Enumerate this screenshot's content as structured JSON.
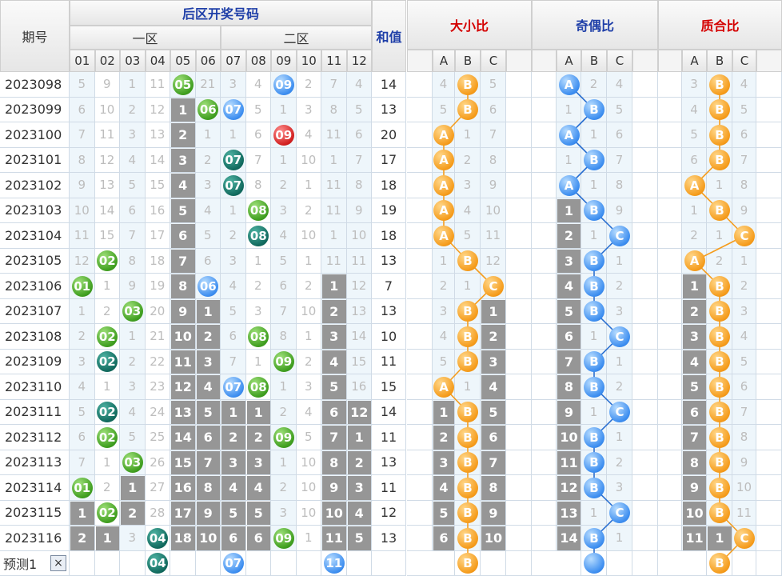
{
  "header": {
    "issue_label": "期号",
    "back_zone_title": "后区开奖号码",
    "zone1_label": "一区",
    "zone2_label": "二区",
    "sum_label": "和值",
    "size_ratio_label": "大小比",
    "parity_ratio_label": "奇偶比",
    "prime_ratio_label": "质合比",
    "numbers": [
      "01",
      "02",
      "03",
      "04",
      "05",
      "06",
      "07",
      "08",
      "09",
      "10",
      "11",
      "12"
    ],
    "abc": [
      "A",
      "B",
      "C"
    ]
  },
  "colors": {
    "size_title": "#d40000",
    "parity_title": "#1f3fa8",
    "prime_title": "#d40000",
    "back_title": "#1f3fa8",
    "sum_title": "#1f3fa8"
  },
  "rows": [
    {
      "issue": "2023098",
      "cells": [
        "5",
        "9",
        "1",
        "11",
        "05",
        "21",
        "3",
        "4",
        "09",
        "2",
        "7",
        "4"
      ],
      "sum": "14",
      "size": [
        "4",
        "B",
        "5"
      ],
      "parity": [
        "A",
        "2",
        "4"
      ],
      "prime": [
        "3",
        "B",
        "4"
      ]
    },
    {
      "issue": "2023099",
      "cells": [
        "6",
        "10",
        "2",
        "12",
        "1",
        "06",
        "07",
        "5",
        "1",
        "3",
        "8",
        "5"
      ],
      "sum": "13",
      "size": [
        "5",
        "B",
        "6"
      ],
      "parity": [
        "1",
        "B",
        "5"
      ],
      "prime": [
        "4",
        "B",
        "5"
      ]
    },
    {
      "issue": "2023100",
      "cells": [
        "7",
        "11",
        "3",
        "13",
        "2",
        "1",
        "1",
        "6",
        "09",
        "4",
        "11",
        "6"
      ],
      "sum": "20",
      "size": [
        "A",
        "1",
        "7"
      ],
      "parity": [
        "A",
        "1",
        "6"
      ],
      "prime": [
        "5",
        "B",
        "6"
      ]
    },
    {
      "issue": "2023101",
      "cells": [
        "8",
        "12",
        "4",
        "14",
        "3",
        "2",
        "07",
        "7",
        "1",
        "10",
        "1",
        "7"
      ],
      "sum": "17",
      "size": [
        "A",
        "2",
        "8"
      ],
      "parity": [
        "1",
        "B",
        "7"
      ],
      "prime": [
        "6",
        "B",
        "7"
      ]
    },
    {
      "issue": "2023102",
      "cells": [
        "9",
        "13",
        "5",
        "15",
        "4",
        "3",
        "07",
        "8",
        "2",
        "1",
        "11",
        "8"
      ],
      "sum": "18",
      "size": [
        "A",
        "3",
        "9"
      ],
      "parity": [
        "A",
        "1",
        "8"
      ],
      "prime": [
        "A",
        "1",
        "8"
      ]
    },
    {
      "issue": "2023103",
      "cells": [
        "10",
        "14",
        "6",
        "16",
        "5",
        "4",
        "1",
        "08",
        "3",
        "2",
        "11",
        "9"
      ],
      "sum": "19",
      "size": [
        "A",
        "4",
        "10"
      ],
      "parity": [
        "1",
        "B",
        "9"
      ],
      "prime": [
        "1",
        "B",
        "9"
      ]
    },
    {
      "issue": "2023104",
      "cells": [
        "11",
        "15",
        "7",
        "17",
        "6",
        "5",
        "2",
        "08",
        "4",
        "10",
        "1",
        "10"
      ],
      "sum": "18",
      "size": [
        "A",
        "5",
        "11"
      ],
      "parity": [
        "2",
        "1",
        "C"
      ],
      "prime": [
        "2",
        "1",
        "C"
      ]
    },
    {
      "issue": "2023105",
      "cells": [
        "12",
        "02",
        "8",
        "18",
        "7",
        "6",
        "3",
        "1",
        "5",
        "1",
        "11",
        "11"
      ],
      "sum": "13",
      "size": [
        "1",
        "B",
        "12"
      ],
      "parity": [
        "3",
        "B",
        "1"
      ],
      "prime": [
        "A",
        "2",
        "1"
      ]
    },
    {
      "issue": "2023106",
      "cells": [
        "01",
        "1",
        "9",
        "19",
        "8",
        "06",
        "4",
        "2",
        "6",
        "2",
        "1",
        "12"
      ],
      "sum": "7",
      "size": [
        "2",
        "1",
        "C"
      ],
      "parity": [
        "4",
        "B",
        "2"
      ],
      "prime": [
        "1",
        "B",
        "2"
      ]
    },
    {
      "issue": "2023107",
      "cells": [
        "1",
        "2",
        "03",
        "20",
        "9",
        "1",
        "5",
        "3",
        "7",
        "10",
        "2",
        "13"
      ],
      "sum": "13",
      "size": [
        "3",
        "B",
        "1"
      ],
      "parity": [
        "5",
        "B",
        "3"
      ],
      "prime": [
        "2",
        "B",
        "3"
      ]
    },
    {
      "issue": "2023108",
      "cells": [
        "2",
        "02",
        "1",
        "21",
        "10",
        "2",
        "6",
        "08",
        "8",
        "1",
        "3",
        "14"
      ],
      "sum": "10",
      "size": [
        "4",
        "B",
        "2"
      ],
      "parity": [
        "6",
        "1",
        "C"
      ],
      "prime": [
        "3",
        "B",
        "4"
      ]
    },
    {
      "issue": "2023109",
      "cells": [
        "3",
        "02",
        "2",
        "22",
        "11",
        "3",
        "7",
        "1",
        "09",
        "2",
        "4",
        "15"
      ],
      "sum": "11",
      "size": [
        "5",
        "B",
        "3"
      ],
      "parity": [
        "7",
        "B",
        "1"
      ],
      "prime": [
        "4",
        "B",
        "5"
      ]
    },
    {
      "issue": "2023110",
      "cells": [
        "4",
        "1",
        "3",
        "23",
        "12",
        "4",
        "07",
        "08",
        "1",
        "3",
        "5",
        "16"
      ],
      "sum": "15",
      "size": [
        "A",
        "1",
        "4"
      ],
      "parity": [
        "8",
        "B",
        "2"
      ],
      "prime": [
        "5",
        "B",
        "6"
      ]
    },
    {
      "issue": "2023111",
      "cells": [
        "5",
        "02",
        "4",
        "24",
        "13",
        "5",
        "1",
        "1",
        "2",
        "4",
        "6",
        "12"
      ],
      "sum": "14",
      "size": [
        "1",
        "B",
        "5"
      ],
      "parity": [
        "9",
        "1",
        "C"
      ],
      "prime": [
        "6",
        "B",
        "7"
      ]
    },
    {
      "issue": "2023112",
      "cells": [
        "6",
        "02",
        "5",
        "25",
        "14",
        "6",
        "2",
        "2",
        "09",
        "5",
        "7",
        "1"
      ],
      "sum": "11",
      "size": [
        "2",
        "B",
        "6"
      ],
      "parity": [
        "10",
        "B",
        "1"
      ],
      "prime": [
        "7",
        "B",
        "8"
      ]
    },
    {
      "issue": "2023113",
      "cells": [
        "7",
        "1",
        "03",
        "26",
        "15",
        "7",
        "3",
        "3",
        "1",
        "10",
        "8",
        "2"
      ],
      "sum": "13",
      "size": [
        "3",
        "B",
        "7"
      ],
      "parity": [
        "11",
        "B",
        "2"
      ],
      "prime": [
        "8",
        "B",
        "9"
      ]
    },
    {
      "issue": "2023114",
      "cells": [
        "01",
        "2",
        "1",
        "27",
        "16",
        "8",
        "4",
        "4",
        "2",
        "10",
        "9",
        "3"
      ],
      "sum": "11",
      "size": [
        "4",
        "B",
        "8"
      ],
      "parity": [
        "12",
        "B",
        "3"
      ],
      "prime": [
        "9",
        "B",
        "10"
      ]
    },
    {
      "issue": "2023115",
      "cells": [
        "1",
        "02",
        "2",
        "28",
        "17",
        "9",
        "5",
        "5",
        "3",
        "10",
        "10",
        "4"
      ],
      "sum": "12",
      "size": [
        "5",
        "B",
        "9"
      ],
      "parity": [
        "13",
        "1",
        "C"
      ],
      "prime": [
        "10",
        "B",
        "11"
      ]
    },
    {
      "issue": "2023116",
      "cells": [
        "2",
        "1",
        "3",
        "04",
        "18",
        "10",
        "6",
        "6",
        "09",
        "1",
        "11",
        "5"
      ],
      "sum": "13",
      "size": [
        "6",
        "B",
        "10"
      ],
      "parity": [
        "14",
        "B",
        "1"
      ],
      "prime": [
        "11",
        "1",
        "C"
      ]
    }
  ],
  "footer": {
    "label": "预测1",
    "close_symbol": "×",
    "balls": [
      "04",
      "07",
      "11"
    ],
    "size_pick": "B",
    "parity_pick": "",
    "prime_pick": "B"
  }
}
